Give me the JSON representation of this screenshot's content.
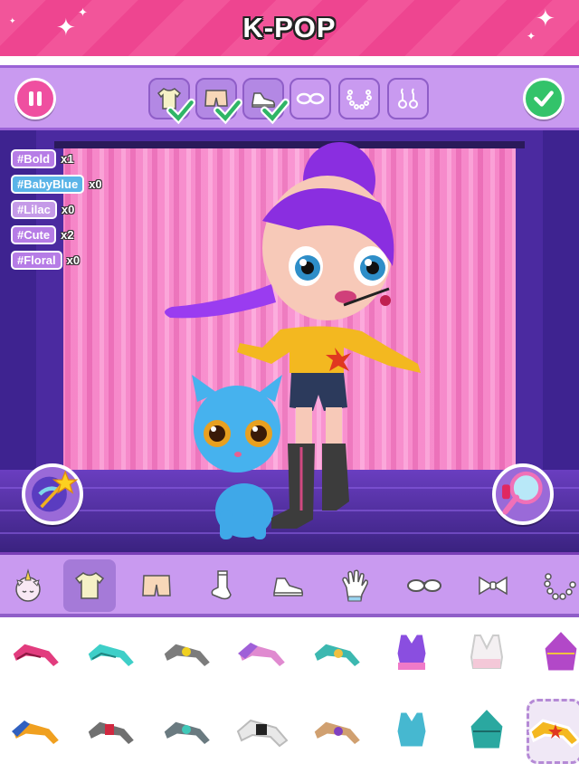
{
  "title": "K-POP",
  "toolbar": {
    "pause_icon": "pause-icon",
    "confirm_icon": "checkmark-icon",
    "slots": [
      {
        "icon": "top-icon",
        "checked": true
      },
      {
        "icon": "shorts-icon",
        "checked": true
      },
      {
        "icon": "sneaker-icon",
        "checked": true
      },
      {
        "icon": "glasses-icon",
        "checked": false
      },
      {
        "icon": "necklace-icon",
        "checked": false
      },
      {
        "icon": "earrings-icon",
        "checked": false
      }
    ]
  },
  "tags": [
    {
      "label": "#Bold",
      "count": "x1",
      "color": "#b67ce6"
    },
    {
      "label": "#BabyBlue",
      "count": "x0",
      "color": "#5ab4e8"
    },
    {
      "label": "#Lilac",
      "count": "x0",
      "color": "#c59ae8"
    },
    {
      "label": "#Cute",
      "count": "x2",
      "color": "#b67ce6"
    },
    {
      "label": "#Floral",
      "count": "x0",
      "color": "#b67ce6"
    }
  ],
  "side_buttons": {
    "left": "magic-wand-icon",
    "right": "mirror-icon"
  },
  "categories": [
    {
      "icon": "unicorn-icon",
      "active": false
    },
    {
      "icon": "top-icon",
      "active": true
    },
    {
      "icon": "shorts-icon",
      "active": false
    },
    {
      "icon": "sock-icon",
      "active": false
    },
    {
      "icon": "sneaker-icon",
      "active": false
    },
    {
      "icon": "glove-icon",
      "active": false
    },
    {
      "icon": "glasses-icon",
      "active": false
    },
    {
      "icon": "bow-icon",
      "active": false
    },
    {
      "icon": "necklace-icon",
      "active": false
    }
  ],
  "items": [
    {
      "name": "pink-jacket",
      "color": "#e23c7e"
    },
    {
      "name": "teal-jacket",
      "color": "#3ecfc8"
    },
    {
      "name": "gray-yellow-jacket",
      "color": "#7c7c7c"
    },
    {
      "name": "pink-purple-jacket",
      "color": "#e08ad0"
    },
    {
      "name": "teal-print-jacket",
      "color": "#3cb8b0"
    },
    {
      "name": "purple-crop-top",
      "color": "#8a4ee0"
    },
    {
      "name": "white-sports-bra",
      "color": "#f4c8d8"
    },
    {
      "name": "purple-halter-top",
      "color": "#b248c8"
    },
    {
      "name": "orange-jacket",
      "color": "#f0a020"
    },
    {
      "name": "red-gray-jacket",
      "color": "#d02840"
    },
    {
      "name": "gray-teal-jacket",
      "color": "#6a7a80"
    },
    {
      "name": "white-black-jacket",
      "color": "#e8e8e8"
    },
    {
      "name": "tan-print-jacket",
      "color": "#d0a070"
    },
    {
      "name": "teal-crop-top",
      "color": "#46b8d0"
    },
    {
      "name": "teal-halter-top",
      "color": "#2aa8a0"
    },
    {
      "name": "yellow-star-jacket",
      "color": "#f4b820",
      "selected": true
    }
  ],
  "colors": {
    "title_bg": "#f2559a",
    "toolbar_bg": "#c99af0",
    "accent_green": "#33c36a",
    "accent_pink": "#ef4fa0"
  }
}
